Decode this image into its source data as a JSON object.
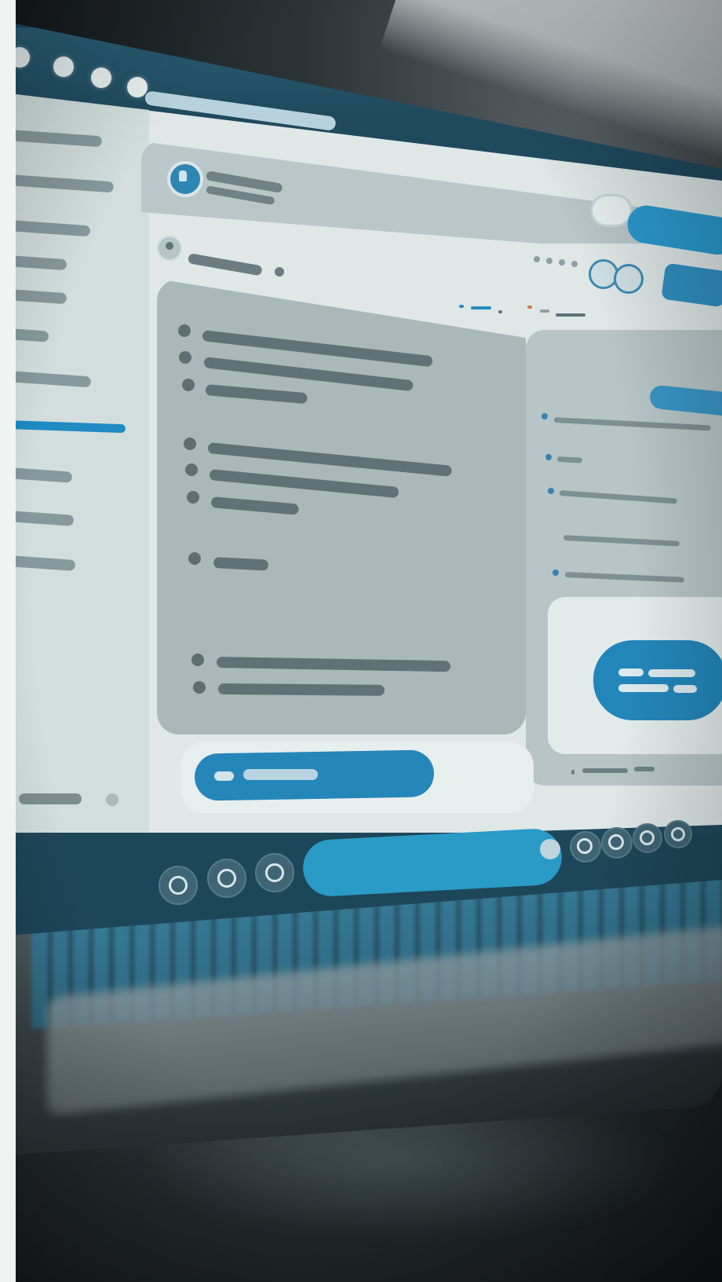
{
  "scene": "photo-of-laptop",
  "colors": {
    "accent": "#2586ba",
    "screen_bg": "#dfe8e7",
    "dock_bg": "#1e4659",
    "placeholder_text": "#5f7276"
  },
  "window": {
    "controls": [
      "close",
      "minimize",
      "maximize"
    ]
  },
  "dock": {
    "left_icons": [
      "app-icon",
      "app-icon",
      "app-icon"
    ],
    "right_icons": [
      "app-icon",
      "app-icon",
      "app-icon",
      "app-icon"
    ]
  }
}
